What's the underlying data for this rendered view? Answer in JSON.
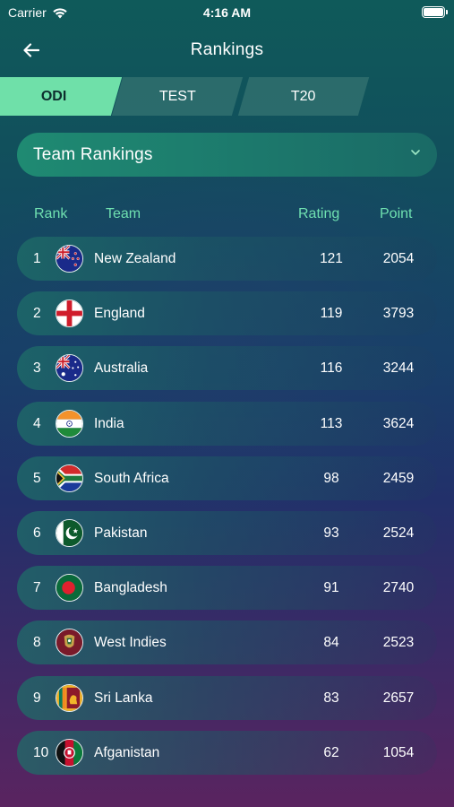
{
  "status_bar": {
    "carrier": "Carrier",
    "time": "4:16 AM"
  },
  "header": {
    "title": "Rankings",
    "back_icon": "arrow-left-icon"
  },
  "tabs": [
    {
      "label": "ODI",
      "active": true
    },
    {
      "label": "TEST",
      "active": false
    },
    {
      "label": "T20",
      "active": false
    }
  ],
  "dropdown": {
    "label": "Team Rankings",
    "icon": "chevron-down-icon"
  },
  "columns": {
    "rank": "Rank",
    "team": "Team",
    "rating": "Rating",
    "point": "Point"
  },
  "colors": {
    "accent": "#6fe0a9",
    "header_text": "#6fe0b0"
  },
  "rankings": [
    {
      "rank": "1",
      "team": "New Zealand",
      "rating": "121",
      "point": "2054",
      "flag_icon": "new-zealand-flag-icon"
    },
    {
      "rank": "2",
      "team": "England",
      "rating": "119",
      "point": "3793",
      "flag_icon": "england-flag-icon"
    },
    {
      "rank": "3",
      "team": "Australia",
      "rating": "116",
      "point": "3244",
      "flag_icon": "australia-flag-icon"
    },
    {
      "rank": "4",
      "team": "India",
      "rating": "113",
      "point": "3624",
      "flag_icon": "india-flag-icon"
    },
    {
      "rank": "5",
      "team": "South Africa",
      "rating": "98",
      "point": "2459",
      "flag_icon": "south-africa-flag-icon"
    },
    {
      "rank": "6",
      "team": "Pakistan",
      "rating": "93",
      "point": "2524",
      "flag_icon": "pakistan-flag-icon"
    },
    {
      "rank": "7",
      "team": "Bangladesh",
      "rating": "91",
      "point": "2740",
      "flag_icon": "bangladesh-flag-icon"
    },
    {
      "rank": "8",
      "team": "West Indies",
      "rating": "84",
      "point": "2523",
      "flag_icon": "west-indies-flag-icon"
    },
    {
      "rank": "9",
      "team": "Sri Lanka",
      "rating": "83",
      "point": "2657",
      "flag_icon": "sri-lanka-flag-icon"
    },
    {
      "rank": "10",
      "team": "Afganistan",
      "rating": "62",
      "point": "1054",
      "flag_icon": "afghanistan-flag-icon"
    }
  ]
}
